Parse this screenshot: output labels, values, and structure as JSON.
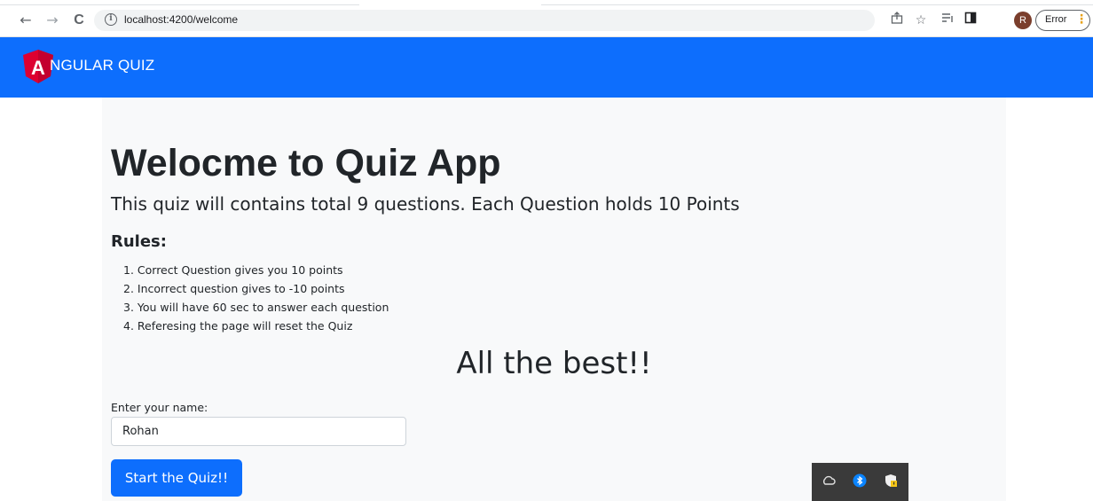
{
  "browser": {
    "url": "localhost:4200/welcome",
    "back_icon": "←",
    "forward_icon": "→",
    "reload_icon": "C",
    "profile_initial": "R",
    "error_label": "Error"
  },
  "navbar": {
    "brand_letter": "A",
    "brand_text": "NGULAR QUIZ",
    "background": "#0d6efd"
  },
  "main": {
    "title": "Welocme to Quiz App",
    "subtitle": "This quiz will contains total 9 questions. Each Question holds 10 Points",
    "rules_title": "Rules:",
    "rules": [
      "1. Correct Question gives you 10 points",
      "2. Incorrect question gives to -10 points",
      "3. You will have 60 sec to answer each question",
      "4. Referesing the page will reset the Quiz"
    ],
    "best_wishes": "All the best!!",
    "name_label": "Enter your name:",
    "name_value": "Rohan",
    "start_button": "Start the Quiz!!"
  },
  "tray": {
    "icons": [
      "onedrive-icon",
      "bluetooth-icon",
      "security-shield-icon"
    ]
  }
}
